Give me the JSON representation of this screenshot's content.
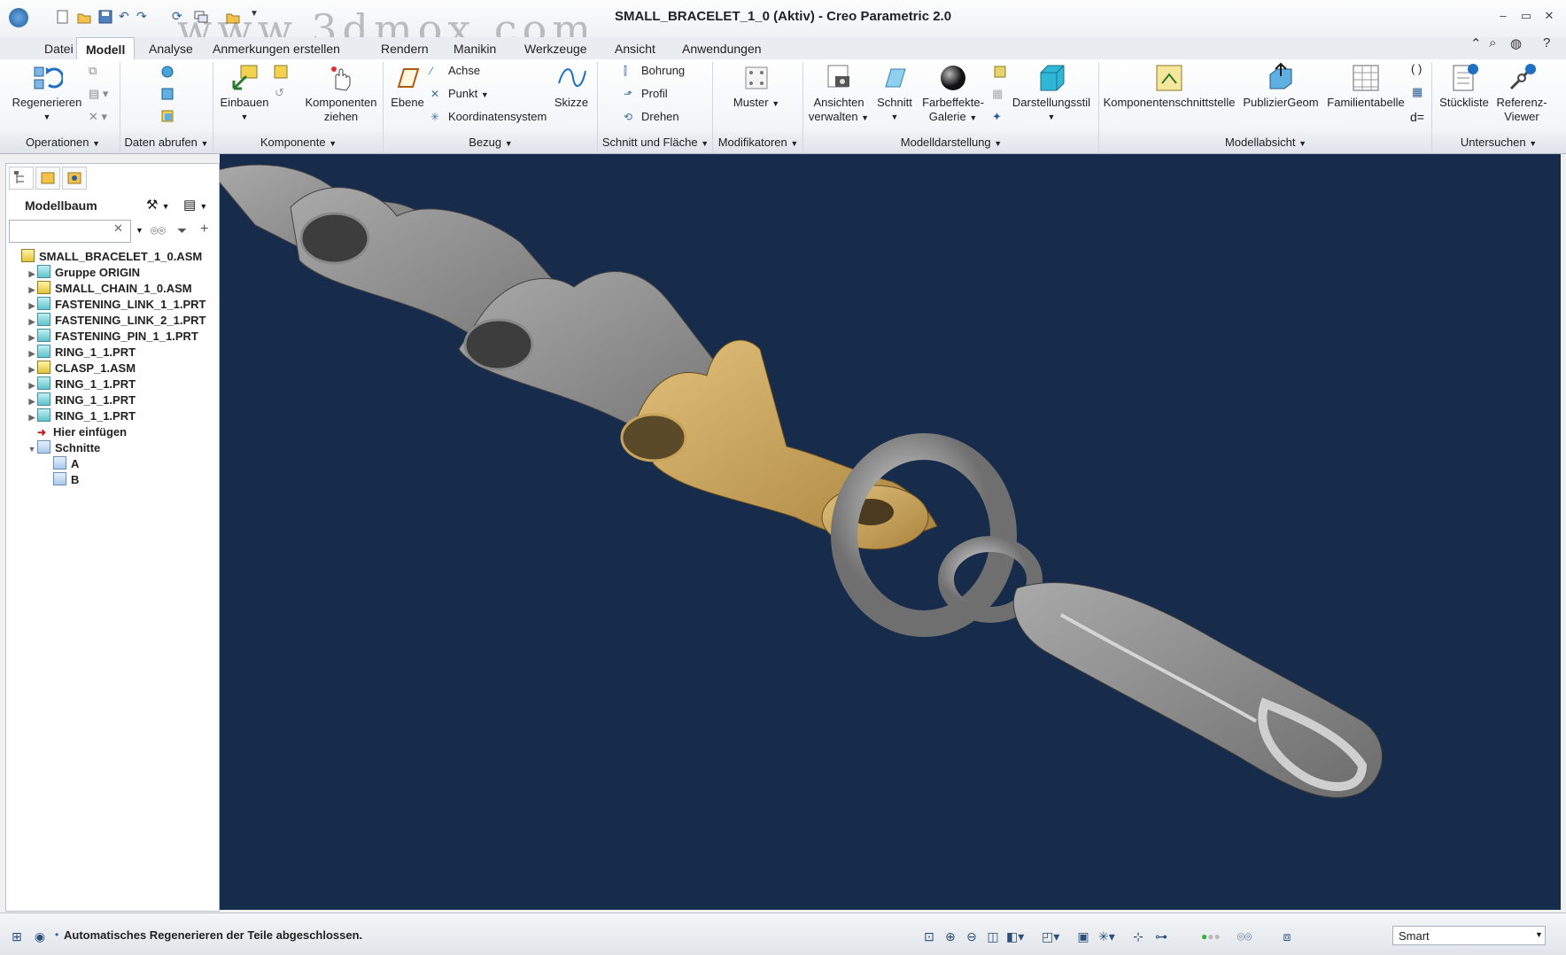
{
  "window": {
    "title": "SMALL_BRACELET_1_0 (Aktiv) - Creo Parametric 2.0",
    "watermark": "www.3dmox.com"
  },
  "tabs": [
    {
      "label": "Datei",
      "active": false
    },
    {
      "label": "Modell",
      "active": true
    },
    {
      "label": "Analyse",
      "active": false
    },
    {
      "label": "Anmerkungen erstellen",
      "active": false
    },
    {
      "label": "Rendern",
      "active": false
    },
    {
      "label": "Manikin",
      "active": false
    },
    {
      "label": "Werkzeuge",
      "active": false
    },
    {
      "label": "Ansicht",
      "active": false
    },
    {
      "label": "Anwendungen",
      "active": false
    }
  ],
  "ribbon": {
    "regenerieren": "Regenerieren",
    "einbauen": "Einbauen",
    "komponenten_ziehen_1": "Komponenten",
    "komponenten_ziehen_2": "ziehen",
    "ebene": "Ebene",
    "achse": "Achse",
    "punkt": "Punkt",
    "koordinatensystem": "Koordinatensystem",
    "skizze": "Skizze",
    "bohrung": "Bohrung",
    "profil": "Profil",
    "drehen": "Drehen",
    "muster": "Muster",
    "ansichten_1": "Ansichten",
    "ansichten_2": "verwalten",
    "schnitt": "Schnitt",
    "farbeffekte_1": "Farbeffekte-",
    "farbeffekte_2": "Galerie",
    "darstellungsstil": "Darstellungsstil",
    "komponentenschnittstelle": "Komponentenschnittstelle",
    "publiziergeom": "PublizierGeom",
    "familientabelle": "Familientabelle",
    "stueckliste": "Stückliste",
    "referenz_1": "Referenz-",
    "referenz_2": "Viewer",
    "d_eq": "d="
  },
  "groups": [
    {
      "label": "Operationen"
    },
    {
      "label": "Daten abrufen"
    },
    {
      "label": "Komponente"
    },
    {
      "label": "Bezug"
    },
    {
      "label": "Schnitt und Fläche"
    },
    {
      "label": "Modifikatoren"
    },
    {
      "label": "Modelldarstellung"
    },
    {
      "label": "Modellabsicht"
    },
    {
      "label": "Untersuchen"
    }
  ],
  "model_tree": {
    "label": "Modellbaum",
    "search_value": "",
    "items": [
      {
        "label": "SMALL_BRACELET_1_0.ASM",
        "kind": "asm",
        "indent": 0,
        "expander": ""
      },
      {
        "label": "Gruppe ORIGIN",
        "kind": "group",
        "indent": 1,
        "expander": "▶"
      },
      {
        "label": "SMALL_CHAIN_1_0.ASM",
        "kind": "asm",
        "indent": 1,
        "expander": "▶"
      },
      {
        "label": "FASTENING_LINK_1_1.PRT",
        "kind": "prt",
        "indent": 1,
        "expander": "▶"
      },
      {
        "label": "FASTENING_LINK_2_1.PRT",
        "kind": "prt",
        "indent": 1,
        "expander": "▶"
      },
      {
        "label": "FASTENING_PIN_1_1.PRT",
        "kind": "prt",
        "indent": 1,
        "expander": "▶"
      },
      {
        "label": "RING_1_1.PRT",
        "kind": "prt",
        "indent": 1,
        "expander": "▶"
      },
      {
        "label": "CLASP_1.ASM",
        "kind": "asm",
        "indent": 1,
        "expander": "▶"
      },
      {
        "label": "RING_1_1.PRT",
        "kind": "prt",
        "indent": 1,
        "expander": "▶"
      },
      {
        "label": "RING_1_1.PRT",
        "kind": "prt",
        "indent": 1,
        "expander": "▶"
      },
      {
        "label": "RING_1_1.PRT",
        "kind": "prt",
        "indent": 1,
        "expander": "▶"
      },
      {
        "label": "Hier einfügen",
        "kind": "insert",
        "indent": 1,
        "expander": ""
      },
      {
        "label": "Schnitte",
        "kind": "sec",
        "indent": 1,
        "expander": "▼"
      },
      {
        "label": "A",
        "kind": "sec",
        "indent": 2,
        "expander": ""
      },
      {
        "label": "B",
        "kind": "sec",
        "indent": 2,
        "expander": ""
      }
    ]
  },
  "status": {
    "message": "Automatisches Regenerieren der Teile abgeschlossen.",
    "filter": "Smart"
  },
  "colors": {
    "viewport_bg": "#172b4a",
    "highlight_part": "#c9a35a",
    "metal": "#8f8f8f"
  }
}
